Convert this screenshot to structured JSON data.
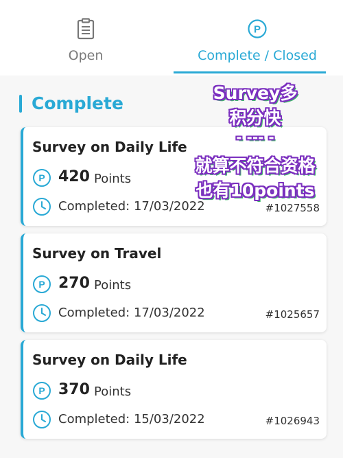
{
  "tabs": {
    "open_label": "Open",
    "complete_label": "Complete / Closed",
    "active": "Complete / Closed",
    "open_icon": "clipboard-icon",
    "complete_icon": "p-points-icon"
  },
  "section": {
    "title": "Complete"
  },
  "surveys": [
    {
      "title": "Survey on Daily Life",
      "points": "420",
      "points_unit": "Points",
      "completed": "Completed: 17/03/2022",
      "ref": "#1027558"
    },
    {
      "title": "Survey on Travel",
      "points": "270",
      "points_unit": "Points",
      "completed": "Completed: 17/03/2022",
      "ref": "#1025657"
    },
    {
      "title": "Survey on Daily Life",
      "points": "370",
      "points_unit": "Points",
      "completed": "Completed: 15/03/2022",
      "ref": "#1026943"
    }
  ],
  "overlay": {
    "line1": "Survey多",
    "line2": "积分快",
    "line3": "- --- -",
    "line4": "就算不符合资格",
    "line5": "也有10points"
  },
  "colors": {
    "accent": "#29a9d5",
    "overlay_outline": "#7b2fbf",
    "overlay_shadow": "#3fb86a"
  }
}
